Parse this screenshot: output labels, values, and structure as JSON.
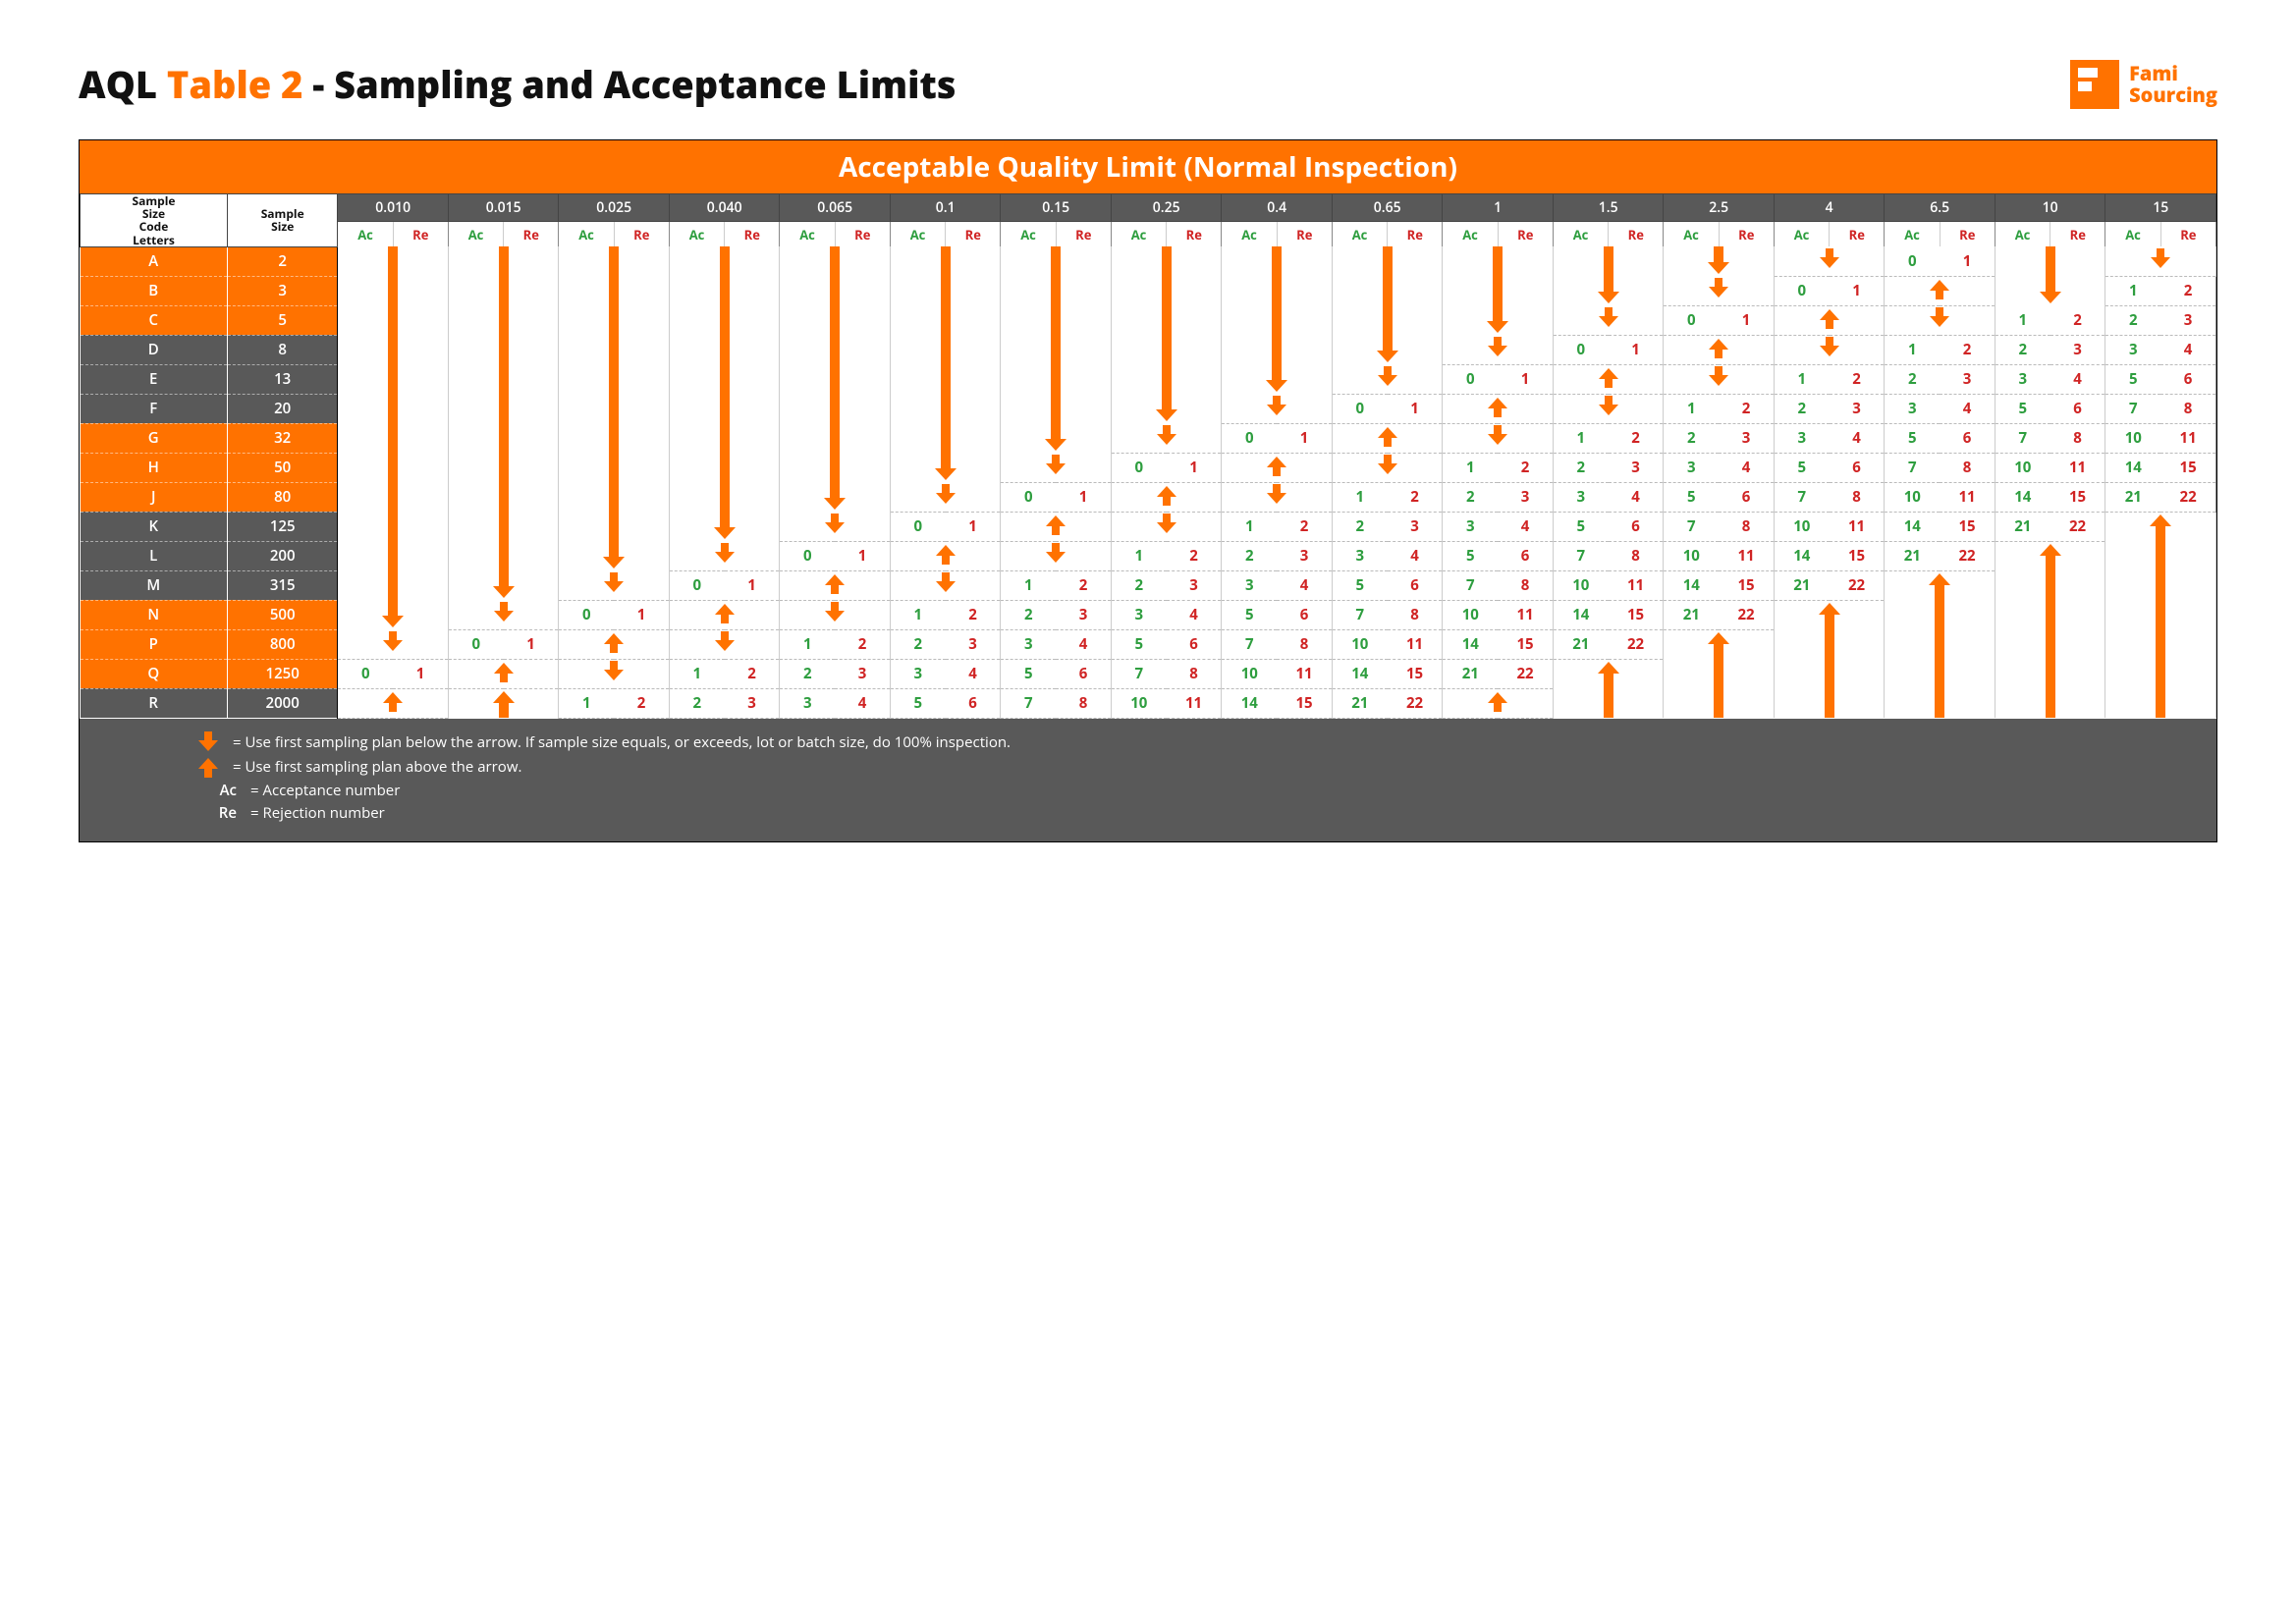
{
  "title_prefix": "AQL ",
  "title_orange": "Table 2",
  "title_suffix": " - Sampling and Acceptance Limits",
  "brand_line1": "Fami",
  "brand_line2": "Sourcing",
  "banner": "Acceptable Quality Limit (Normal Inspection)",
  "hdr_letters": "Sample Size Code Letters",
  "hdr_size": "Sample Size",
  "ac_label": "Ac",
  "re_label": "Re",
  "legend": {
    "down": "= Use first sampling plan below the arrow.  If sample size equals, or exceeds, lot or batch size, do 100% inspection.",
    "up": "= Use first sampling plan above the arrow.",
    "ac": "= Acceptance number",
    "re": "= Rejection number"
  },
  "aql_levels": [
    "0.010",
    "0.015",
    "0.025",
    "0.040",
    "0.065",
    "0.1",
    "0.15",
    "0.25",
    "0.4",
    "0.65",
    "1",
    "1.5",
    "2.5",
    "4",
    "6.5",
    "10",
    "15"
  ],
  "groups": [
    {
      "color": "orange",
      "rows": [
        {
          "letter": "A",
          "size": "2"
        },
        {
          "letter": "B",
          "size": "3"
        },
        {
          "letter": "C",
          "size": "5"
        }
      ]
    },
    {
      "color": "grey",
      "rows": [
        {
          "letter": "D",
          "size": "8"
        },
        {
          "letter": "E",
          "size": "13"
        },
        {
          "letter": "F",
          "size": "20"
        }
      ]
    },
    {
      "color": "orange",
      "rows": [
        {
          "letter": "G",
          "size": "32"
        },
        {
          "letter": "H",
          "size": "50"
        },
        {
          "letter": "J",
          "size": "80"
        }
      ]
    },
    {
      "color": "grey",
      "rows": [
        {
          "letter": "K",
          "size": "125"
        },
        {
          "letter": "L",
          "size": "200"
        },
        {
          "letter": "M",
          "size": "315"
        }
      ]
    },
    {
      "color": "orange",
      "rows": [
        {
          "letter": "N",
          "size": "500"
        },
        {
          "letter": "P",
          "size": "800"
        },
        {
          "letter": "Q",
          "size": "1250"
        }
      ]
    },
    {
      "color": "grey",
      "rows": [
        {
          "letter": "R",
          "size": "2000"
        }
      ]
    }
  ],
  "cells": {
    "A": [
      "D",
      "D",
      "D",
      "D",
      "D",
      "D",
      "D",
      "D",
      "D",
      "D",
      "D",
      "D",
      "D",
      "SD",
      [
        0,
        1
      ],
      "D",
      "SD"
    ],
    "B": [
      "D",
      "D",
      "D",
      "D",
      "D",
      "D",
      "D",
      "D",
      "D",
      "D",
      "D",
      "D",
      "SD",
      [
        0,
        1
      ],
      "SU",
      "D",
      [
        1,
        2
      ]
    ],
    "C": [
      "D",
      "D",
      "D",
      "D",
      "D",
      "D",
      "D",
      "D",
      "D",
      "D",
      "D",
      "SD",
      [
        0,
        1
      ],
      "SU",
      "SD",
      [
        1,
        2
      ],
      [
        2,
        3
      ]
    ],
    "D": [
      "D",
      "D",
      "D",
      "D",
      "D",
      "D",
      "D",
      "D",
      "D",
      "D",
      "SD",
      [
        0,
        1
      ],
      "SU",
      "SD",
      [
        1,
        2
      ],
      [
        2,
        3
      ],
      [
        3,
        4
      ]
    ],
    "E": [
      "D",
      "D",
      "D",
      "D",
      "D",
      "D",
      "D",
      "D",
      "D",
      "SD",
      [
        0,
        1
      ],
      "SU",
      "SD",
      [
        1,
        2
      ],
      [
        2,
        3
      ],
      [
        3,
        4
      ],
      [
        5,
        6
      ]
    ],
    "F": [
      "D",
      "D",
      "D",
      "D",
      "D",
      "D",
      "D",
      "D",
      "SD",
      [
        0,
        1
      ],
      "SU",
      "SD",
      [
        1,
        2
      ],
      [
        2,
        3
      ],
      [
        3,
        4
      ],
      [
        5,
        6
      ],
      [
        7,
        8
      ]
    ],
    "G": [
      "D",
      "D",
      "D",
      "D",
      "D",
      "D",
      "D",
      "SD",
      [
        0,
        1
      ],
      "SU",
      "SD",
      [
        1,
        2
      ],
      [
        2,
        3
      ],
      [
        3,
        4
      ],
      [
        5,
        6
      ],
      [
        7,
        8
      ],
      [
        10,
        11
      ]
    ],
    "H": [
      "D",
      "D",
      "D",
      "D",
      "D",
      "D",
      "SD",
      [
        0,
        1
      ],
      "SU",
      "SD",
      [
        1,
        2
      ],
      [
        2,
        3
      ],
      [
        3,
        4
      ],
      [
        5,
        6
      ],
      [
        7,
        8
      ],
      [
        10,
        11
      ],
      [
        14,
        15
      ]
    ],
    "J": [
      "D",
      "D",
      "D",
      "D",
      "D",
      "SD",
      [
        0,
        1
      ],
      "SU",
      "SD",
      [
        1,
        2
      ],
      [
        2,
        3
      ],
      [
        3,
        4
      ],
      [
        5,
        6
      ],
      [
        7,
        8
      ],
      [
        10,
        11
      ],
      [
        14,
        15
      ],
      [
        21,
        22
      ]
    ],
    "K": [
      "D",
      "D",
      "D",
      "D",
      "SD",
      [
        0,
        1
      ],
      "SU",
      "SD",
      [
        1,
        2
      ],
      [
        2,
        3
      ],
      [
        3,
        4
      ],
      [
        5,
        6
      ],
      [
        7,
        8
      ],
      [
        10,
        11
      ],
      [
        14,
        15
      ],
      [
        21,
        22
      ],
      "U"
    ],
    "L": [
      "D",
      "D",
      "D",
      "SD",
      [
        0,
        1
      ],
      "SU",
      "SD",
      [
        1,
        2
      ],
      [
        2,
        3
      ],
      [
        3,
        4
      ],
      [
        5,
        6
      ],
      [
        7,
        8
      ],
      [
        10,
        11
      ],
      [
        14,
        15
      ],
      [
        21,
        22
      ],
      "U",
      "U"
    ],
    "M": [
      "D",
      "D",
      "SD",
      [
        0,
        1
      ],
      "SU",
      "SD",
      [
        1,
        2
      ],
      [
        2,
        3
      ],
      [
        3,
        4
      ],
      [
        5,
        6
      ],
      [
        7,
        8
      ],
      [
        10,
        11
      ],
      [
        14,
        15
      ],
      [
        21,
        22
      ],
      "U",
      "U",
      "U"
    ],
    "N": [
      "D",
      "SD",
      [
        0,
        1
      ],
      "SU",
      "SD",
      [
        1,
        2
      ],
      [
        2,
        3
      ],
      [
        3,
        4
      ],
      [
        5,
        6
      ],
      [
        7,
        8
      ],
      [
        10,
        11
      ],
      [
        14,
        15
      ],
      [
        21,
        22
      ],
      "U",
      "U",
      "U",
      "U"
    ],
    "P": [
      "SD",
      [
        0,
        1
      ],
      "SU",
      "SD",
      [
        1,
        2
      ],
      [
        2,
        3
      ],
      [
        3,
        4
      ],
      [
        5,
        6
      ],
      [
        7,
        8
      ],
      [
        10,
        11
      ],
      [
        14,
        15
      ],
      [
        21,
        22
      ],
      "U",
      "U",
      "U",
      "U",
      "U"
    ],
    "Q": [
      [
        0,
        1
      ],
      "SU",
      "SD",
      [
        1,
        2
      ],
      [
        2,
        3
      ],
      [
        3,
        4
      ],
      [
        5,
        6
      ],
      [
        7,
        8
      ],
      [
        10,
        11
      ],
      [
        14,
        15
      ],
      [
        21,
        22
      ],
      "U",
      "U",
      "U",
      "U",
      "U",
      "U"
    ],
    "R": [
      "SU",
      "U",
      [
        1,
        2
      ],
      [
        2,
        3
      ],
      [
        3,
        4
      ],
      [
        5,
        6
      ],
      [
        7,
        8
      ],
      [
        10,
        11
      ],
      [
        14,
        15
      ],
      [
        21,
        22
      ],
      "SU",
      "U",
      "U",
      "U",
      "U",
      "U",
      "U"
    ]
  }
}
